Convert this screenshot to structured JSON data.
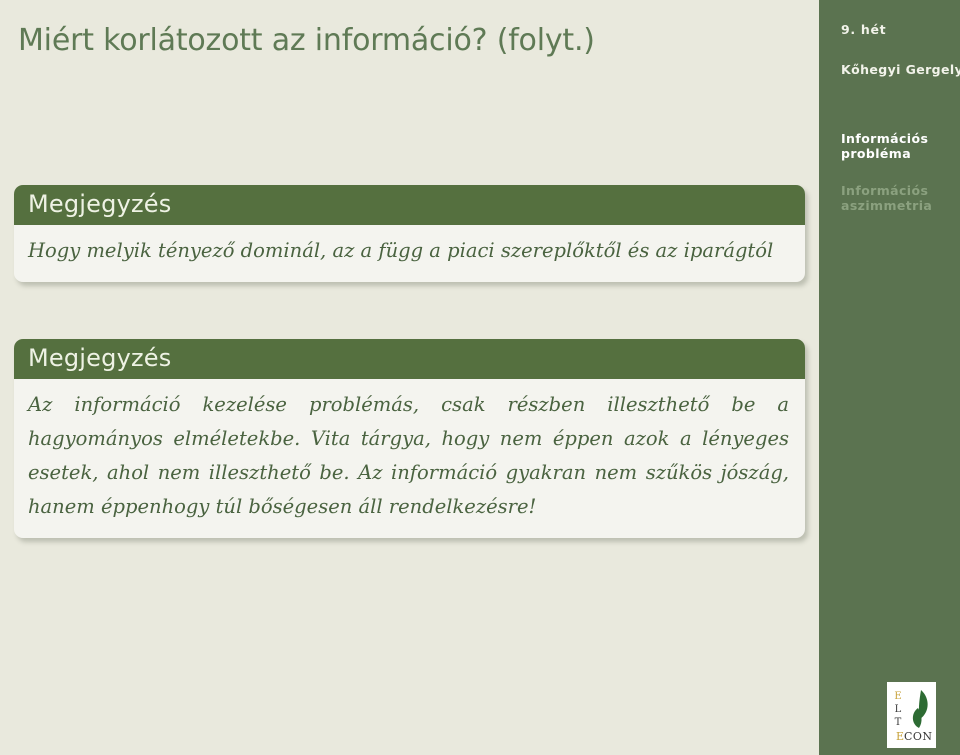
{
  "slide": {
    "title": "Miért korlátozott az információ? (folyt.)",
    "background_color": "#e9e9dd",
    "accent_color": "#55703f",
    "sidebar_color": "#5b7350"
  },
  "sidebar": {
    "week": "9. hét",
    "author": "Kőhegyi Gergely",
    "nav_items": [
      {
        "line1": "Információs",
        "line2": "probléma",
        "state": "active"
      },
      {
        "line1": "Információs",
        "line2": "aszimmetria",
        "state": "inactive"
      }
    ],
    "logo": {
      "letters": [
        "E",
        "L",
        "T"
      ],
      "wordmark_first": "E",
      "wordmark_rest": "CON",
      "leaf_color": "#2d6b33",
      "accent_letter_color": "#c8a33c"
    }
  },
  "blocks": [
    {
      "header": "Megjegyzés",
      "body": "Hogy melyik tényező dominál, az a függ a piaci szereplőktől és az iparágtól"
    },
    {
      "header": "Megjegyzés",
      "body": "Az információ kezelése problémás, csak részben illeszthető be a hagyományos elméletekbe. Vita tárgya, hogy nem éppen azok a lényeges esetek, ahol nem illeszthető be. Az információ gyakran nem szűkös jószág, hanem éppenhogy túl bőségesen áll rendelkezésre!"
    }
  ]
}
